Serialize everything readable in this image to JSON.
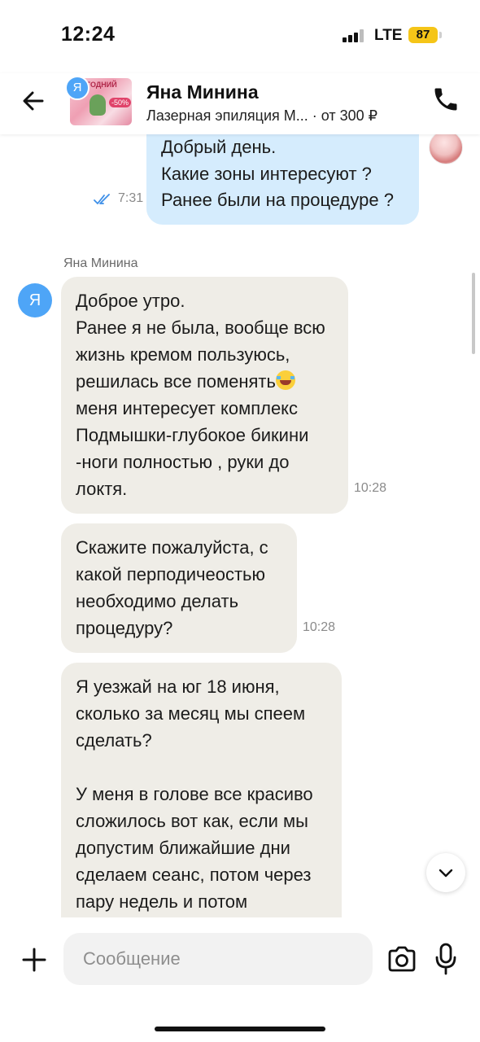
{
  "status_bar": {
    "time": "12:24",
    "network": "LTE",
    "battery": "87"
  },
  "header": {
    "back_icon": "arrow-left-icon",
    "contact_initial": "Я",
    "contact_name": "Яна Минина",
    "listing_info": "Лазерная эпиляция М... · от 300 ₽",
    "thumb_text": "ГОДНИЙ",
    "thumb_badge": "-50%",
    "call_icon": "phone-icon"
  },
  "messages": {
    "outgoing": {
      "text": "Добрый день.\nКакие зоны интересуют ?\nРанее были на процедуре ?",
      "time": "7:31",
      "status_icon": "double-check-icon"
    },
    "sender_name": "Яна Минина",
    "sender_initial": "Я",
    "incoming": [
      {
        "text_before_emoji": "Доброе утро.\nРанее я не была, вообще всю жизнь кремом пользуюсь, решилась все поменять",
        "emoji": "laughing-crying-emoji",
        "text_after_emoji": "\nменя интересует комплекс Подмышки-глубокое бикини -ноги  полностью , руки до локтя.",
        "time": "10:28"
      },
      {
        "text": "Скажите пожалуйста, с какой перподичеостью необходимо делать процедуру?",
        "time": "10:28"
      },
      {
        "text": "Я уезжай  на юг 18 июня, сколько за месяц мы спеем сделать?\n\nУ меня в голове все красиво сложилось вот как, если мы допустим ближайшие дни сделаем сеанс, потом через пару недель и потом"
      }
    ]
  },
  "composer": {
    "placeholder": "Сообщение",
    "value": ""
  },
  "colors": {
    "outgoing_bubble": "#d5ecfd",
    "incoming_bubble": "#efede7",
    "avatar_blue": "#4ea5f7",
    "battery_yellow": "#f5c518",
    "read_check_blue": "#3d8fe8"
  }
}
